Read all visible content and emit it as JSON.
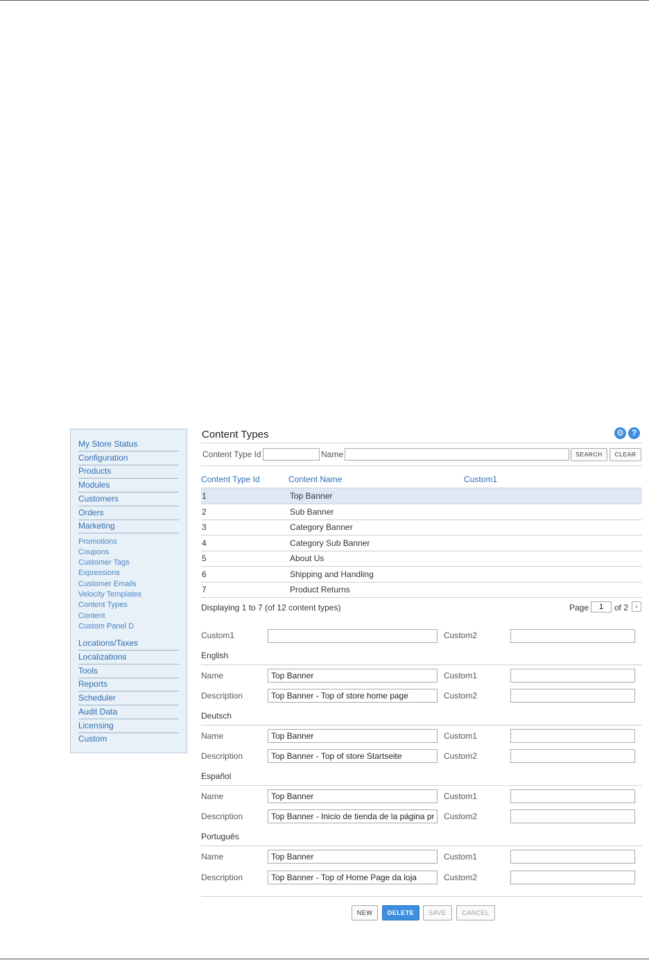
{
  "sidebar": {
    "items": [
      "My Store Status",
      "Configuration",
      "Products",
      "Modules",
      "Customers",
      "Orders",
      "Marketing"
    ],
    "subitems": [
      "Promotions",
      "Coupons",
      "Customer Tags",
      "Expressions",
      "Customer Emails",
      "Velocity Templates",
      "Content Types",
      "Content",
      "Custom Panel D"
    ],
    "items2": [
      "Locations/Taxes",
      "Localizations",
      "Tools",
      "Reports",
      "Scheduler",
      "Audit Data",
      "Licensing",
      "Custom"
    ]
  },
  "header": {
    "title": "Content Types",
    "settings_icon": "gear-icon",
    "help_icon": "help-icon",
    "help_glyph": "?",
    "settings_glyph": "⚙"
  },
  "search": {
    "id_label": "Content Type Id",
    "id_value": "",
    "name_label": "Name",
    "name_value": "",
    "search_button": "SEARCH",
    "clear_button": "CLEAR"
  },
  "table": {
    "columns": [
      "Content Type Id",
      "Content Name",
      "Custom1"
    ],
    "rows": [
      {
        "id": "1",
        "name": "Top Banner",
        "custom1": ""
      },
      {
        "id": "2",
        "name": "Sub Banner",
        "custom1": ""
      },
      {
        "id": "3",
        "name": "Category Banner",
        "custom1": ""
      },
      {
        "id": "4",
        "name": "Category Sub Banner",
        "custom1": ""
      },
      {
        "id": "5",
        "name": "About Us",
        "custom1": ""
      },
      {
        "id": "6",
        "name": "Shipping and Handling",
        "custom1": ""
      },
      {
        "id": "7",
        "name": "Product Returns",
        "custom1": ""
      }
    ],
    "selected_row": 0
  },
  "pager": {
    "info": "Displaying 1 to 7 (of 12 content types)",
    "page_label": "Page",
    "page_value": "1",
    "of_label": "of 2",
    "next_glyph": "›"
  },
  "form": {
    "custom1_label": "Custom1",
    "custom2_label": "Custom2",
    "custom1_value": "",
    "custom2_value": "",
    "name_label": "Name",
    "description_label": "Description",
    "languages": [
      {
        "name": "English",
        "name_value": "Top Banner",
        "description_value": "Top Banner - Top of store home page",
        "custom1": "",
        "custom2": ""
      },
      {
        "name": "Deutsch",
        "name_value": "Top Banner",
        "description_value": "Top Banner - Top of store Startseite",
        "custom1": "",
        "custom2": ""
      },
      {
        "name": "Español",
        "name_value": "Top Banner",
        "description_value": "Top Banner - Inicio de tienda de la página principal",
        "custom1": "",
        "custom2": ""
      },
      {
        "name": "Português",
        "name_value": "Top Banner",
        "description_value": "Top Banner - Top of Home Page da loja",
        "custom1": "",
        "custom2": ""
      }
    ]
  },
  "actions": {
    "new": "NEW",
    "delete": "DELETE",
    "save": "SAVE",
    "cancel": "CANCEL"
  },
  "colors": {
    "accent": "#3d8ee0",
    "link": "#2f6db0",
    "sidebar_bg": "#e8f0f8",
    "selected_row": "#dde8f4"
  }
}
